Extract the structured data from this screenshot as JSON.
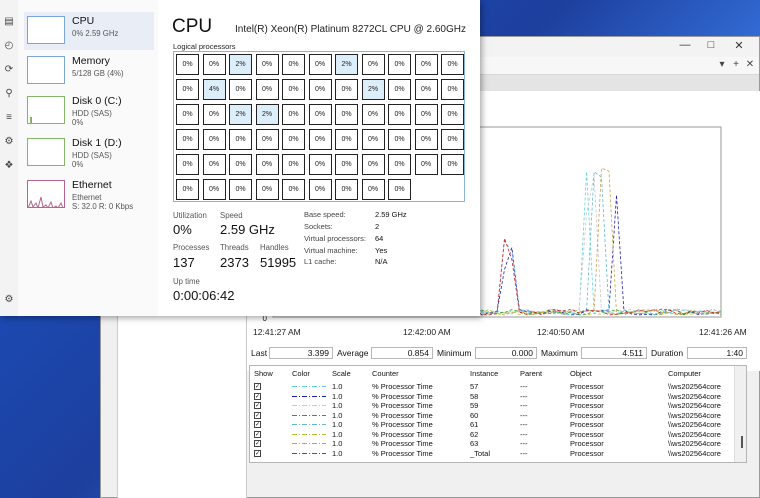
{
  "task_manager": {
    "strip_icons": [
      "performance-icon",
      "app-history-icon",
      "startup-apps-icon",
      "users-icon",
      "details-icon",
      "services-icon",
      "settings-icon"
    ],
    "sidebar": [
      {
        "name": "CPU",
        "sub1": "0% 2.59 GHz",
        "sub2": "",
        "sub3": ""
      },
      {
        "name": "Memory",
        "sub1": "5/128 GB (4%)",
        "sub2": "",
        "sub3": ""
      },
      {
        "name": "Disk 0 (C:)",
        "sub1": "HDD (SAS)",
        "sub2": "0%",
        "sub3": ""
      },
      {
        "name": "Disk 1 (D:)",
        "sub1": "HDD (SAS)",
        "sub2": "0%",
        "sub3": ""
      },
      {
        "name": "Ethernet",
        "sub1": "Ethernet",
        "sub2": "S: 32.0 R: 0 Kbps",
        "sub3": ""
      }
    ],
    "title": "CPU",
    "cpu_model": "Intel(R) Xeon(R) Platinum 8272CL CPU @ 2.60GHz",
    "logical_processors_label": "Logical processors",
    "logical_processors": [
      "0%",
      "0%",
      "2%",
      "0%",
      "0%",
      "0%",
      "2%",
      "0%",
      "0%",
      "0%",
      "0%",
      "0%",
      "4%",
      "0%",
      "0%",
      "0%",
      "0%",
      "0%",
      "2%",
      "0%",
      "0%",
      "0%",
      "0%",
      "0%",
      "2%",
      "2%",
      "0%",
      "0%",
      "0%",
      "0%",
      "0%",
      "0%",
      "0%",
      "0%",
      "0%",
      "0%",
      "0%",
      "0%",
      "0%",
      "0%",
      "0%",
      "0%",
      "0%",
      "0%",
      "0%",
      "0%",
      "0%",
      "0%",
      "0%",
      "0%",
      "0%",
      "0%",
      "0%",
      "0%",
      "0%",
      "0%",
      "0%",
      "0%",
      "0%",
      "0%",
      "0%",
      "0%",
      "0%",
      "0%"
    ],
    "highlight_color": "#ddeefb",
    "metrics": {
      "utilization_label": "Utilization",
      "utilization": "0%",
      "speed_label": "Speed",
      "speed": "2.59 GHz",
      "processes_label": "Processes",
      "processes": "137",
      "threads_label": "Threads",
      "threads": "2373",
      "handles_label": "Handles",
      "handles": "51995",
      "uptime_label": "Up time",
      "uptime": "0:00:06:42"
    },
    "specs": [
      {
        "key": "Base speed:",
        "value": "2.59 GHz"
      },
      {
        "key": "Sockets:",
        "value": "2"
      },
      {
        "key": "Virtual processors:",
        "value": "64"
      },
      {
        "key": "Virtual machine:",
        "value": "Yes"
      },
      {
        "key": "L1 cache:",
        "value": "N/A"
      }
    ]
  },
  "perfmon": {
    "window_controls": [
      "minimize-icon",
      "maximize-icon",
      "close-icon"
    ],
    "toolbar": [
      "dropdown-icon",
      "add-icon",
      "delete-icon",
      "highlight-icon"
    ],
    "time_axis": [
      "12:41:27 AM",
      "12:42:00 AM",
      "12:40:50 AM",
      "12:41:26 AM"
    ],
    "y_axis_bottom": "0",
    "stats": {
      "last_label": "Last",
      "last": "3.399",
      "average_label": "Average",
      "average": "0.854",
      "minimum_label": "Minimum",
      "minimum": "0.000",
      "maximum_label": "Maximum",
      "maximum": "4.511",
      "duration_label": "Duration",
      "duration": "1:40"
    },
    "table_headers": [
      "Show",
      "Color",
      "Scale",
      "Counter",
      "Instance",
      "Parent",
      "Object",
      "Computer"
    ],
    "counters": [
      {
        "color": "#5fd3e0",
        "scale": "1.0",
        "counter": "% Processor Time",
        "instance": "57",
        "parent": "---",
        "object": "Processor",
        "computer": "\\\\ws202564core"
      },
      {
        "color": "#1f1fa8",
        "scale": "1.0",
        "counter": "% Processor Time",
        "instance": "58",
        "parent": "---",
        "object": "Processor",
        "computer": "\\\\ws202564core"
      },
      {
        "color": "#c8c8c8",
        "scale": "1.0",
        "counter": "% Processor Time",
        "instance": "59",
        "parent": "---",
        "object": "Processor",
        "computer": "\\\\ws202564core"
      },
      {
        "color": "#2aa02a",
        "scale": "1.0",
        "counter": "% Processor Time",
        "instance": "60",
        "parent": "---",
        "object": "Processor",
        "computer": "\\\\ws202564core"
      },
      {
        "color": "#5fb8d8",
        "scale": "1.0",
        "counter": "% Processor Time",
        "instance": "61",
        "parent": "---",
        "object": "Processor",
        "computer": "\\\\ws202564core"
      },
      {
        "color": "#b8c030",
        "scale": "1.0",
        "counter": "% Processor Time",
        "instance": "62",
        "parent": "---",
        "object": "Processor",
        "computer": "\\\\ws202564core"
      },
      {
        "color": "#c8a050",
        "scale": "1.0",
        "counter": "% Processor Time",
        "instance": "63",
        "parent": "---",
        "object": "Processor",
        "computer": "\\\\ws202564core"
      },
      {
        "color": "#d02020",
        "scale": "1.0",
        "counter": "% Processor Time",
        "instance": "_Total",
        "parent": "---",
        "object": "Processor",
        "computer": "\\\\ws202564core"
      }
    ]
  }
}
